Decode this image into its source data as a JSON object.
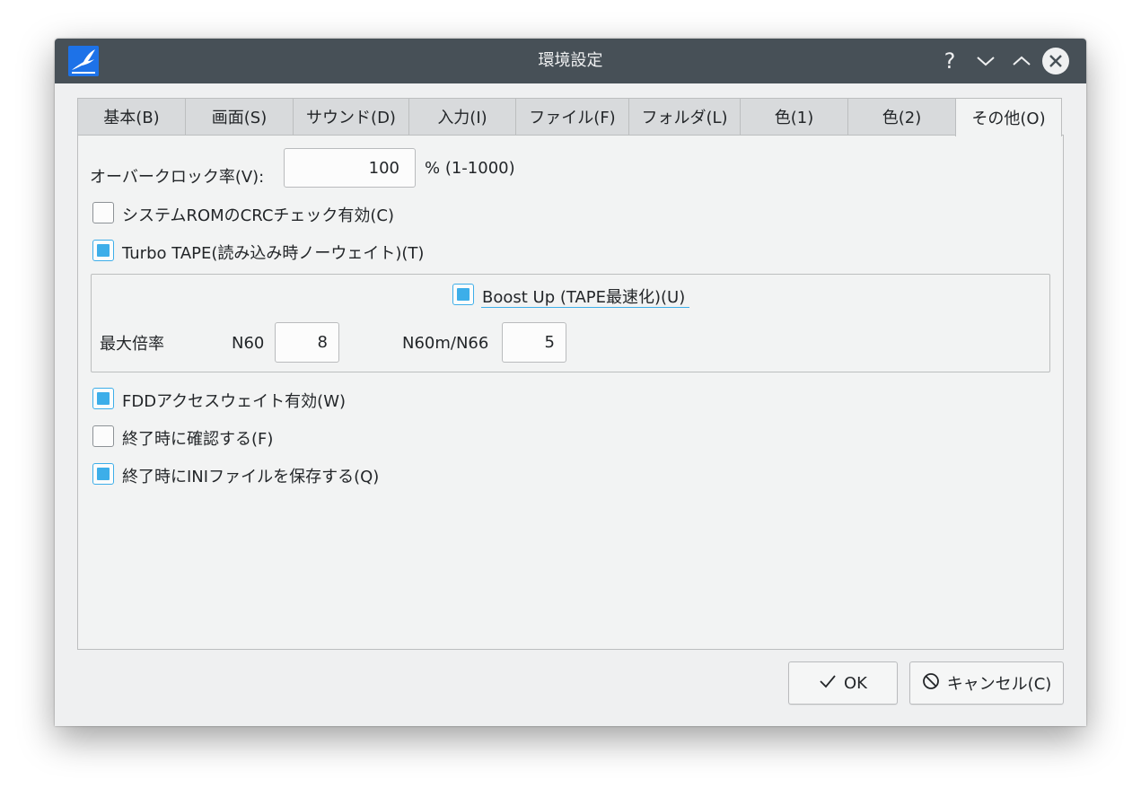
{
  "window": {
    "title": "環境設定"
  },
  "titlebar": {
    "help_icon": "help-icon",
    "help_glyph": "?",
    "minimize_icon": "chevron-down-icon",
    "maximize_icon": "chevron-up-icon",
    "close_icon": "close-icon"
  },
  "tabs": [
    {
      "label": "基本(B)",
      "active": false
    },
    {
      "label": "画面(S)",
      "active": false
    },
    {
      "label": "サウンド(D)",
      "active": false
    },
    {
      "label": "入力(I)",
      "active": false
    },
    {
      "label": "ファイル(F)",
      "active": false
    },
    {
      "label": "フォルダ(L)",
      "active": false
    },
    {
      "label": "色(1)",
      "active": false
    },
    {
      "label": "色(2)",
      "active": false
    },
    {
      "label": "その他(O)",
      "active": true
    }
  ],
  "overclock": {
    "label": "オーバークロック率(V):",
    "value": "100",
    "range": "% (1-1000)"
  },
  "options": {
    "rom_crc": {
      "label": "システムROMのCRCチェック有効(C)",
      "checked": false
    },
    "turbo_tape": {
      "label": "Turbo TAPE(読み込み時ノーウェイト)(T)",
      "checked": true
    },
    "fdd_wait": {
      "label": "FDDアクセスウェイト有効(W)",
      "checked": true
    },
    "confirm_exit": {
      "label": "終了時に確認する(F)",
      "checked": false
    },
    "save_ini": {
      "label": "終了時にINIファイルを保存する(Q)",
      "checked": true
    }
  },
  "boost": {
    "label": "Boost Up (TAPE最速化)(U)",
    "checked": true,
    "max_rate_label": "最大倍率",
    "n60_label": "N60",
    "n60_value": "8",
    "n60m_label": "N60m/N66",
    "n60m_value": "5"
  },
  "buttons": {
    "ok_label": "OK",
    "ok_icon": "checkmark-icon",
    "cancel_label": "キャンセル(C)",
    "cancel_icon": "cancel-icon"
  },
  "colors": {
    "titlebar": "#475057",
    "accent": "#3daee9",
    "background": "#eff0f1"
  }
}
